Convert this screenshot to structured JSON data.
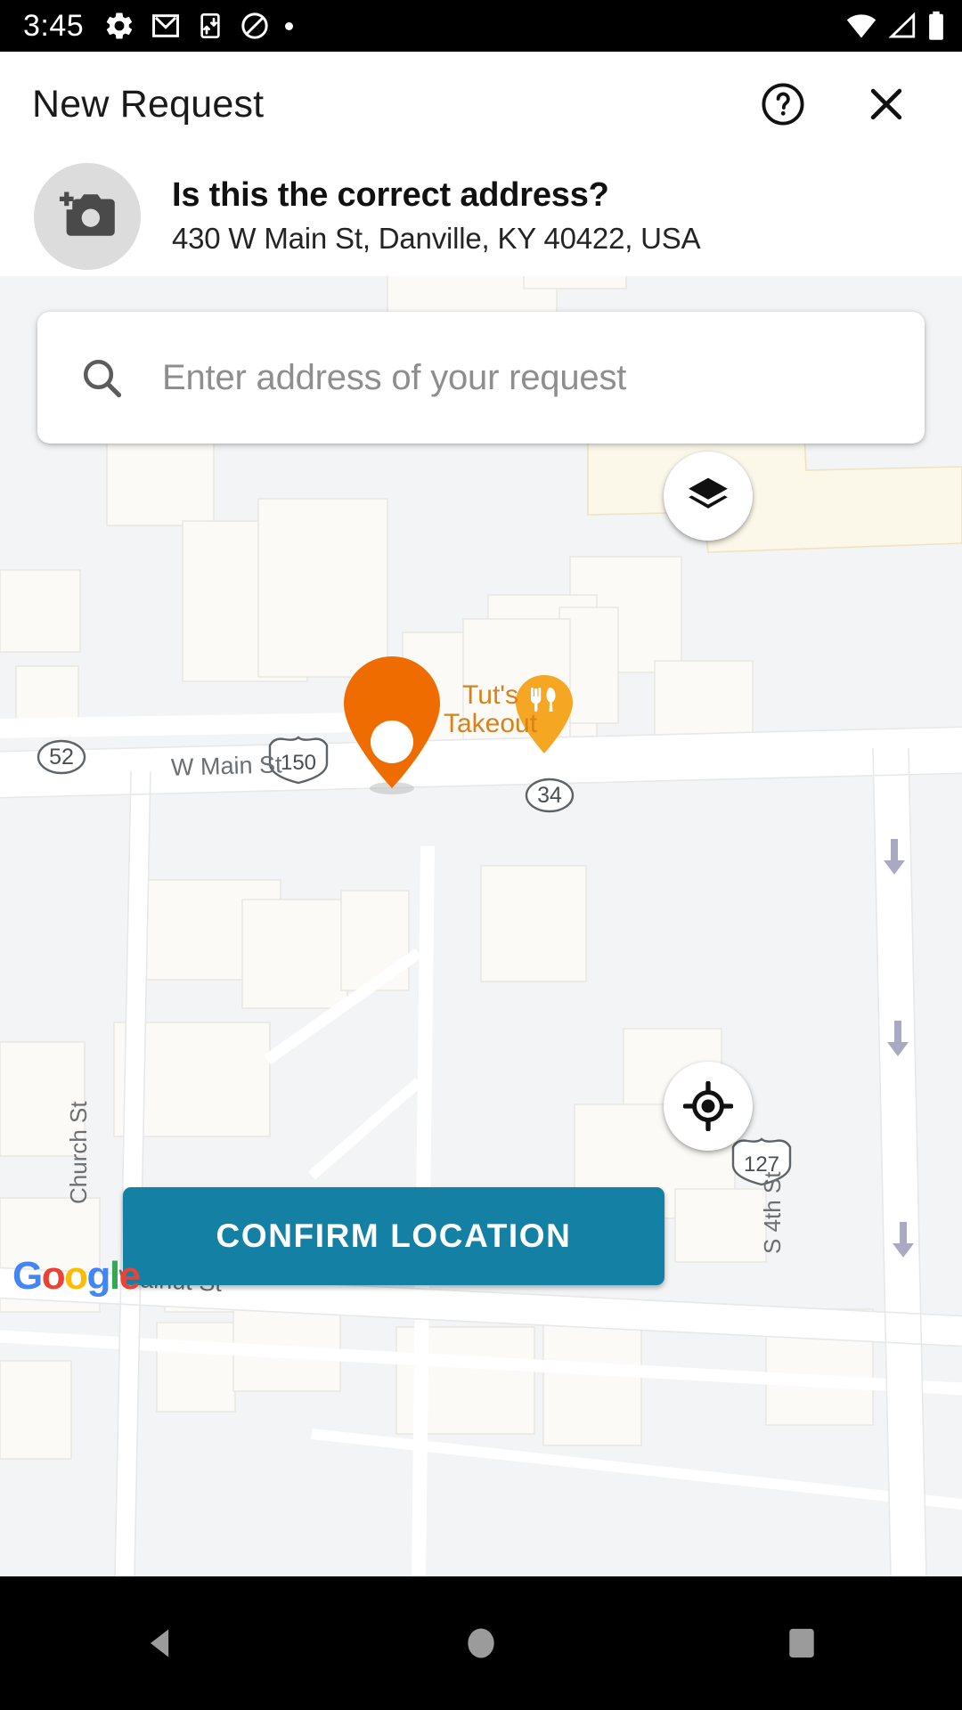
{
  "status_bar": {
    "time": "3:45",
    "left_icons": [
      "settings-gear-icon",
      "gmail-icon",
      "sync-download-icon",
      "do-not-disturb-icon",
      "dot-indicator-icon"
    ],
    "right_icons": [
      "wifi-icon",
      "cell-signal-icon",
      "battery-icon"
    ]
  },
  "header": {
    "title": "New Request",
    "help_icon": "help-circle-icon",
    "close_icon": "close-x-icon"
  },
  "address_prompt": {
    "thumbnail_icon": "add-photo-camera-icon",
    "question": "Is this the correct address?",
    "address": "430 W Main St, Danville, KY 40422, USA"
  },
  "search": {
    "icon": "search-icon",
    "placeholder": "Enter address of your request",
    "value": ""
  },
  "map": {
    "layers_button_icon": "map-layers-icon",
    "my_location_button_icon": "my-location-crosshair-icon",
    "selected_pin_icon": "location-pin-marker",
    "attribution": "Google",
    "attribution_letters": [
      "G",
      "o",
      "o",
      "g",
      "l",
      "e"
    ],
    "poi": {
      "name_line1": "Tut's",
      "name_line2": "Takeout",
      "icon": "restaurant-pin-icon"
    },
    "street_labels": [
      {
        "name": "W Main St"
      },
      {
        "name": "Church St"
      },
      {
        "name": "S 4th St"
      },
      {
        "name": "Walnut St"
      }
    ],
    "route_shields": [
      {
        "label": "52",
        "type": "oval"
      },
      {
        "label": "150",
        "type": "us-highway"
      },
      {
        "label": "34",
        "type": "oval"
      },
      {
        "label": "127",
        "type": "us-highway"
      }
    ],
    "colors": {
      "pin": "#ef6c00",
      "poi_text": "#d9821a",
      "poi_pin": "#f5a623",
      "map_background": "#f2f4f5",
      "building": "#fbfaf6",
      "road": "#ffffff",
      "accent": "#1380a4"
    }
  },
  "actions": {
    "confirm_label": "CONFIRM LOCATION"
  },
  "nav_bar": {
    "back_icon": "nav-back-triangle-icon",
    "home_icon": "nav-home-circle-icon",
    "recents_icon": "nav-recents-square-icon"
  }
}
